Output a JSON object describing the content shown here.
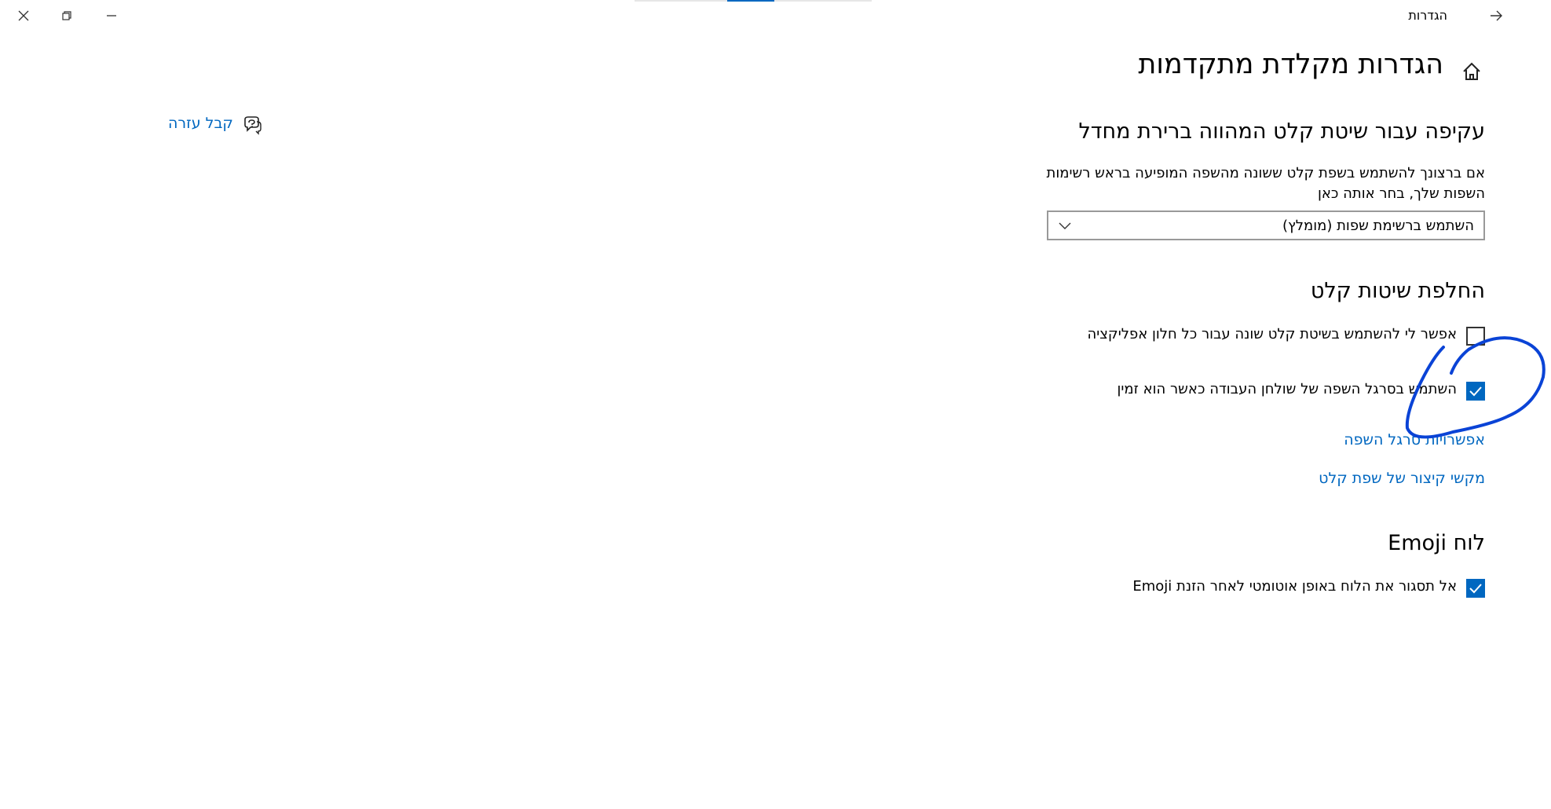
{
  "window": {
    "title": "הגדרות",
    "back_icon": "arrow-right-icon",
    "minimize_icon": "minimize-icon",
    "restore_icon": "restore-icon",
    "close_icon": "close-icon"
  },
  "page": {
    "title": "הגדרות מקלדת מתקדמות",
    "home_icon": "home-icon"
  },
  "help": {
    "label": "קבל עזרה",
    "icon": "help-chat-icon"
  },
  "override_section": {
    "title": "עקיפה עבור שיטת קלט המהווה ברירת מחדל",
    "description": "אם ברצונך להשתמש בשפת קלט ששונה מהשפה המופיעה בראש רשימות השפות שלך, בחר אותה כאן",
    "dropdown_value": "השתמש ברשימת שפות (מומלץ)"
  },
  "switching_section": {
    "title": "החלפת שיטות קלט",
    "checkbox_per_app": {
      "label": "אפשר לי להשתמש בשיטת קלט שונה עבור כל חלון אפליקציה",
      "checked": false
    },
    "checkbox_language_bar": {
      "label": "השתמש בסרגל השפה של שולחן העבודה כאשר הוא זמין",
      "checked": true
    },
    "link_language_bar_options": "אפשרויות סרגל השפה",
    "link_hotkeys": "מקשי קיצור של שפת קלט"
  },
  "emoji_section": {
    "title": "לוח Emoji",
    "checkbox_keep_open": {
      "label": "אל תסגור את הלוח באופן אוטומטי לאחר הזנת Emoji",
      "checked": true
    }
  },
  "colors": {
    "accent": "#0067c0",
    "annotation": "#0a43d6"
  }
}
